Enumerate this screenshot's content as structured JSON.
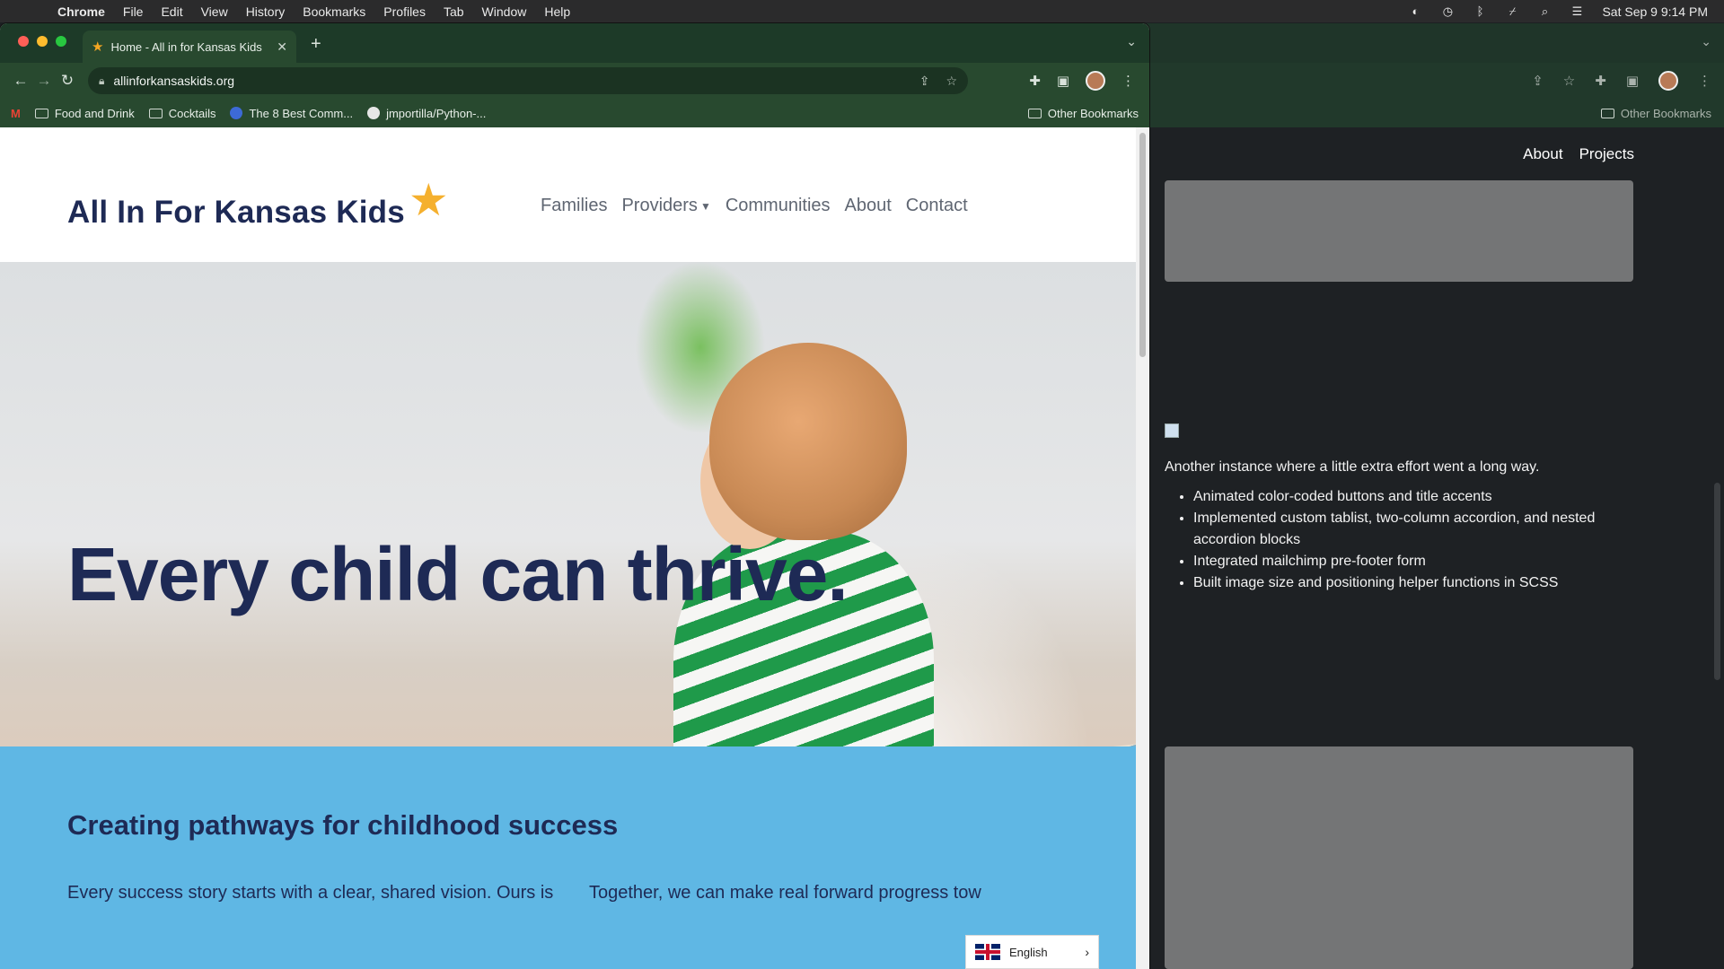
{
  "menubar": {
    "app": "Chrome",
    "items": [
      "File",
      "Edit",
      "View",
      "History",
      "Bookmarks",
      "Profiles",
      "Tab",
      "Window",
      "Help"
    ],
    "clock": "Sat Sep 9  9:14 PM"
  },
  "browser": {
    "tab_title": "Home - All in for Kansas Kids",
    "url": "allinforkansaskids.org",
    "bookmarks": [
      "Food and Drink",
      "Cocktails",
      "The 8 Best Comm...",
      "jmportilla/Python-..."
    ],
    "other_bookmarks": "Other Bookmarks"
  },
  "site": {
    "logo_text": "All In For Kansas Kids",
    "nav": [
      "Families",
      "Providers",
      "Communities",
      "About",
      "Contact"
    ],
    "hero_title": "Every child can thrive.",
    "section_title": "Creating pathways for childhood success",
    "col1_text": "Every success story starts with a clear, shared vision. Ours is",
    "col2_text": "Together, we can make real forward progress tow",
    "language": "English"
  },
  "background_window": {
    "nav": [
      "About",
      "Projects"
    ],
    "other_bookmarks": "Other Bookmarks",
    "description": "Another instance where a little extra effort went a long way.",
    "bullets": [
      "Animated color-coded buttons and title accents",
      "Implemented custom tablist, two-column accordion, and nested accordion blocks",
      "Integrated mailchimp pre-footer form",
      "Built image size and positioning helper functions in SCSS"
    ]
  }
}
